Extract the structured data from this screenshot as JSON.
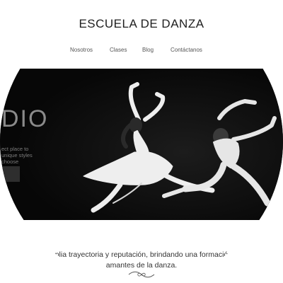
{
  "header": {
    "brand": "ESCUELA DE DANZA"
  },
  "nav": {
    "items": [
      {
        "label": "Nosotros"
      },
      {
        "label": "Clases"
      },
      {
        "label": "Blog"
      },
      {
        "label": "Contáctanos"
      }
    ]
  },
  "hero": {
    "overlay_title": "DIO",
    "overlay_lines": [
      "ect place to",
      "unique styles",
      "choose"
    ],
    "image_description_icon": "dancers-photo"
  },
  "intro": {
    "line1": "amplia trayectoria y reputación, brindando una formación d",
    "line2": "amantes de la danza."
  },
  "colors": {
    "hero_bg": "#0b0b0b",
    "text": "#1e1e1e",
    "nav_text": "#555555"
  }
}
